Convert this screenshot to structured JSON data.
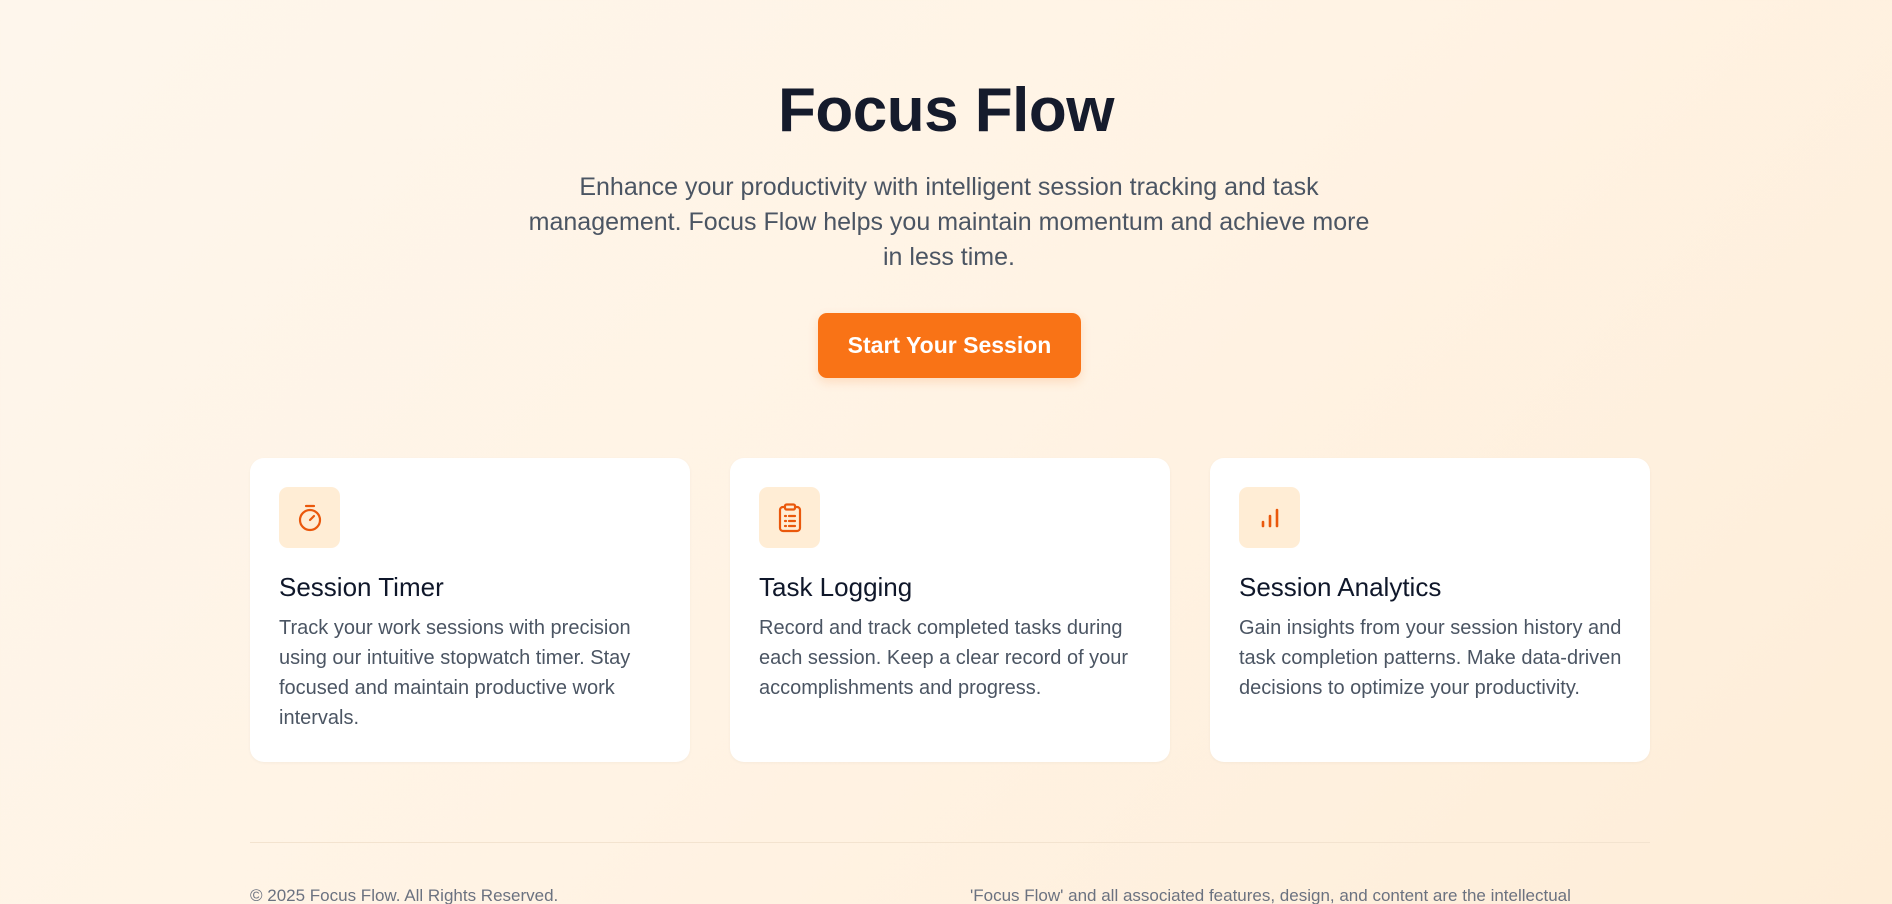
{
  "hero": {
    "title": "Focus Flow",
    "subtitle": "Enhance your productivity with intelligent session tracking and task management. Focus Flow helps you maintain momentum and achieve more in less time.",
    "cta_label": "Start Your Session"
  },
  "features": [
    {
      "icon": "stopwatch-icon",
      "title": "Session Timer",
      "description": "Track your work sessions with precision using our intuitive stopwatch timer. Stay focused and maintain productive work intervals."
    },
    {
      "icon": "clipboard-list-icon",
      "title": "Task Logging",
      "description": "Record and track completed tasks during each session. Keep a clear record of your accomplishments and progress."
    },
    {
      "icon": "bar-chart-icon",
      "title": "Session Analytics",
      "description": "Gain insights from your session history and task completion patterns. Make data-driven decisions to optimize your productivity."
    }
  ],
  "footer": {
    "copyright": "© 2025 Focus Flow. All Rights Reserved.",
    "legal": "'Focus Flow' and all associated features, design, and content are the intellectual"
  },
  "colors": {
    "accent": "#f97316",
    "icon_bg": "#ffedd5",
    "title": "#151b2c",
    "body_text": "#4b5563"
  }
}
